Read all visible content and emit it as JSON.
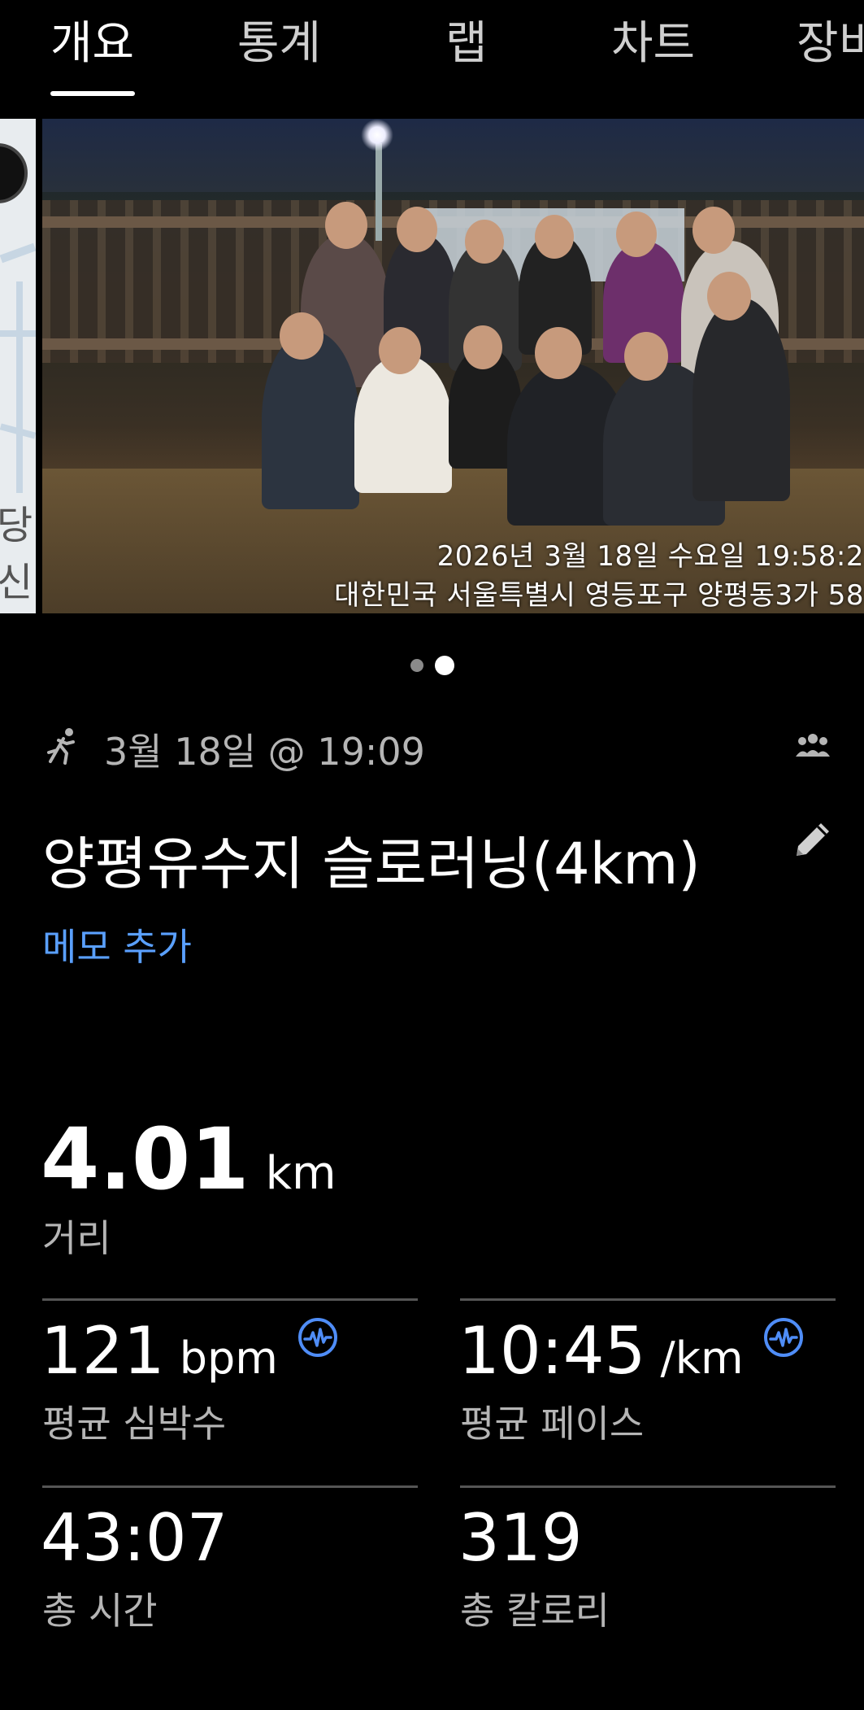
{
  "tabs": [
    {
      "label": "개요",
      "active": true
    },
    {
      "label": "통계",
      "active": false
    },
    {
      "label": "랩",
      "active": false
    },
    {
      "label": "차트",
      "active": false
    },
    {
      "label": "장비",
      "active": false
    }
  ],
  "map_thumb": {
    "place_text": "당신"
  },
  "photo": {
    "timestamp": "2026년 3월 18일 수요일 19:58:2",
    "location": "대한민국 서울특별시 영등포구 양평동3가 58"
  },
  "carousel": {
    "page_count": 2,
    "current_page": 2
  },
  "activity": {
    "date_time": "3월 18일 @ 19:09",
    "title": "양평유수지 슬로러닝(4km)",
    "memo_link": "메모 추가"
  },
  "stats": {
    "distance": {
      "value": "4.01",
      "unit": "km",
      "label": "거리"
    },
    "avg_heart_rate": {
      "value": "121",
      "unit": "bpm",
      "label": "평균 심박수"
    },
    "avg_pace": {
      "value": "10:45",
      "unit": "/km",
      "label": "평균 페이스"
    },
    "total_time": {
      "value": "43:07",
      "label": "총 시간"
    },
    "total_calories": {
      "value": "319",
      "label": "총 칼로리"
    }
  },
  "colors": {
    "background": "#000000",
    "accent_link": "#5aa0ff",
    "icon_blue": "#4f8df7",
    "secondary_text": "#b5b5b5"
  },
  "icons": [
    "running-icon",
    "group-icon",
    "pencil-icon",
    "heart-rate-icon"
  ]
}
